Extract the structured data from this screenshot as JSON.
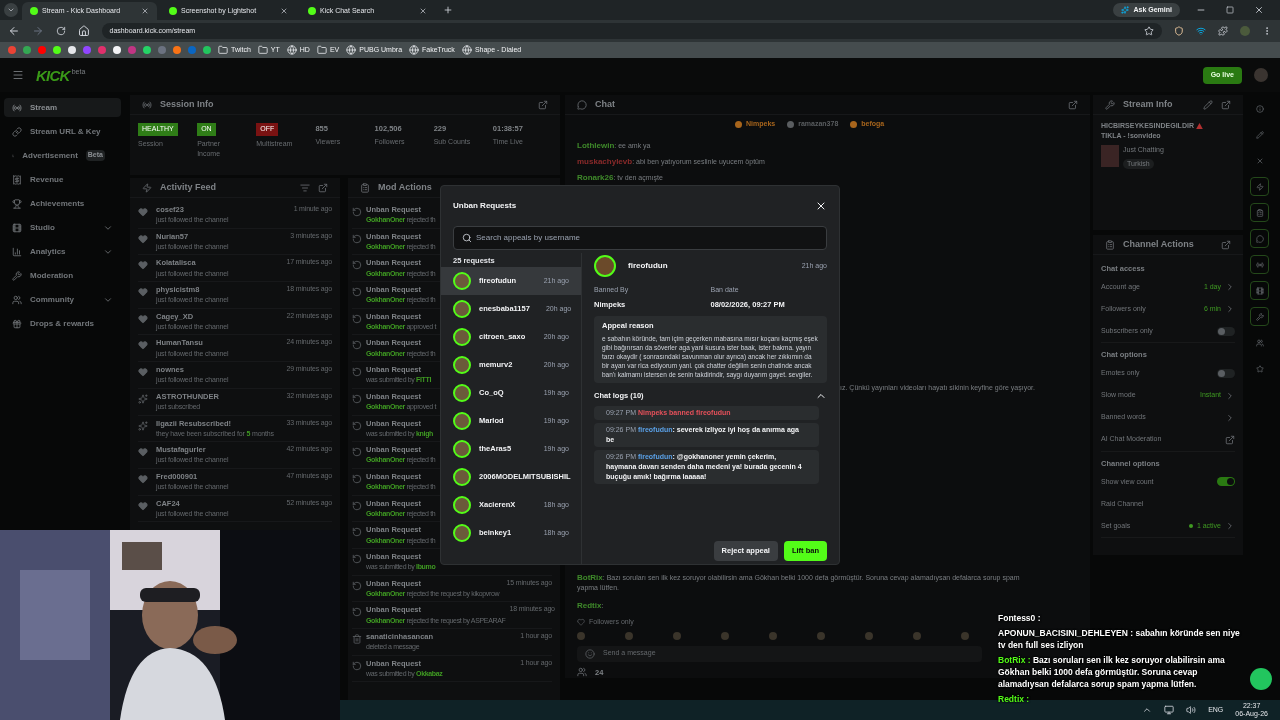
{
  "browser": {
    "tabs": [
      {
        "title": "Stream - Kick Dashboard",
        "selected": true
      },
      {
        "title": "Screenshot by Lightshot",
        "selected": false
      },
      {
        "title": "Kick Chat Search",
        "selected": false
      }
    ],
    "url": "dashboard.kick.com/stream",
    "assistant_button": "Ask Gemini",
    "bookmarks": [
      {
        "label": "Twitch",
        "kind": "folder"
      },
      {
        "label": "YT",
        "kind": "folder"
      },
      {
        "label": "HD",
        "kind": "site"
      },
      {
        "label": "EV",
        "kind": "folder"
      },
      {
        "label": "PUBG Umbra",
        "kind": "site"
      },
      {
        "label": "FakeTruck",
        "kind": "site"
      },
      {
        "label": "Shape - Dialed",
        "kind": "site"
      }
    ]
  },
  "header": {
    "logo": "KICK",
    "logo_tag": "beta",
    "go_live": "Go live"
  },
  "sidebar": {
    "items": [
      {
        "label": "Stream",
        "selected": true,
        "expandable": false
      },
      {
        "label": "Stream URL & Key",
        "selected": false,
        "expandable": false
      },
      {
        "label": "Advertisement",
        "badge": "Beta",
        "selected": false,
        "expandable": false
      },
      {
        "label": "Revenue",
        "selected": false,
        "expandable": false
      },
      {
        "label": "Achievements",
        "selected": false,
        "expandable": false
      },
      {
        "label": "Studio",
        "selected": false,
        "expandable": true
      },
      {
        "label": "Analytics",
        "selected": false,
        "expandable": true
      },
      {
        "label": "Moderation",
        "selected": false,
        "expandable": false
      },
      {
        "label": "Community",
        "selected": false,
        "expandable": true
      },
      {
        "label": "Drops & rewards",
        "selected": false,
        "expandable": false
      }
    ]
  },
  "session_info": {
    "title": "Session Info",
    "stats": [
      {
        "kind": "badge",
        "value": "HEALTHY",
        "label": "Session",
        "color": "#2f7d17"
      },
      {
        "kind": "badge",
        "value": "ON",
        "label": "Partner Income",
        "color": "#2f7d17"
      },
      {
        "kind": "badge",
        "value": "OFF",
        "label": "Multistream",
        "color": "#7a1212"
      },
      {
        "kind": "number",
        "value": "855",
        "label": "Viewers"
      },
      {
        "kind": "number",
        "value": "102,506",
        "label": "Followers"
      },
      {
        "kind": "number",
        "value": "229",
        "label": "Sub Counts"
      },
      {
        "kind": "number",
        "value": "01:38:57",
        "label": "Time Live"
      }
    ]
  },
  "activity_feed": {
    "title": "Activity Feed",
    "items": [
      {
        "kind": "follow",
        "name": "cosef23",
        "sub": "just followed the channel",
        "time": "1 minute ago"
      },
      {
        "kind": "follow",
        "name": "Nurian57",
        "sub": "just followed the channel",
        "time": "3 minutes ago"
      },
      {
        "kind": "follow",
        "name": "Kolatalisca",
        "sub": "just followed the channel",
        "time": "17 minutes ago"
      },
      {
        "kind": "follow",
        "name": "physicistm8",
        "sub": "just followed the channel",
        "time": "18 minutes ago"
      },
      {
        "kind": "follow",
        "name": "Cagey_XD",
        "sub": "just followed the channel",
        "time": "22 minutes ago"
      },
      {
        "kind": "follow",
        "name": "HumanTansu",
        "sub": "just followed the channel",
        "time": "24 minutes ago"
      },
      {
        "kind": "follow",
        "name": "nownes",
        "sub": "just followed the channel",
        "time": "29 minutes ago"
      },
      {
        "kind": "subscribe",
        "name": "ASTROTHUNDER",
        "sub": "just subscribed",
        "time": "32 minutes ago"
      },
      {
        "kind": "subscribe",
        "name": "Ilgazii Resubscribed!",
        "sub": "they have been subscribed for ",
        "highlight": "5",
        "sub_end": " months",
        "time": "33 minutes ago"
      },
      {
        "kind": "follow",
        "name": "Mustafagurler",
        "sub": "just followed the channel",
        "time": "42 minutes ago"
      },
      {
        "kind": "follow",
        "name": "Fred000901",
        "sub": "just followed the channel",
        "time": "47 minutes ago"
      },
      {
        "kind": "follow",
        "name": "CAF24",
        "sub": "just followed the channel",
        "time": "52 minutes ago"
      }
    ]
  },
  "mod_actions": {
    "title": "Mod Actions",
    "items": [
      {
        "kind": "unban",
        "title": "Unban Request",
        "name": "GokhanOner",
        "after": " rejected th"
      },
      {
        "kind": "unban",
        "title": "Unban Request",
        "name": "GokhanOner",
        "after": " rejected th"
      },
      {
        "kind": "unban",
        "title": "Unban Request",
        "name": "GokhanOner",
        "after": " rejected th"
      },
      {
        "kind": "unban",
        "title": "Unban Request",
        "name": "GokhanOner",
        "after": " rejected th"
      },
      {
        "kind": "unban",
        "title": "Unban Request",
        "name": "GokhanOner",
        "after": " approved t"
      },
      {
        "kind": "unban",
        "title": "Unban Request",
        "name": "GokhanOner",
        "after": " rejected th"
      },
      {
        "kind": "unban",
        "title": "Unban Request",
        "before": "was submitted by ",
        "name": "FITTI"
      },
      {
        "kind": "unban",
        "title": "Unban Request",
        "name": "GokhanOner",
        "after": " approved t"
      },
      {
        "kind": "unban",
        "title": "Unban Request",
        "before": "was submitted by ",
        "name": "knigh"
      },
      {
        "kind": "unban",
        "title": "Unban Request",
        "name": "GokhanOner",
        "after": " rejected th"
      },
      {
        "kind": "unban",
        "title": "Unban Request",
        "name": "GokhanOner",
        "after": " rejected th"
      },
      {
        "kind": "unban",
        "title": "Unban Request",
        "name": "GokhanOner",
        "after": " rejected th"
      },
      {
        "kind": "unban",
        "title": "Unban Request",
        "name": "GokhanOner",
        "after": " rejected th"
      },
      {
        "kind": "unban",
        "title": "Unban Request",
        "before": "was submitted by ",
        "name": "Ibumo"
      },
      {
        "kind": "unban",
        "title": "Unban Request",
        "name": "GokhanOner",
        "after": " rejected the request by kikopvrow",
        "time": "15 minutes ago"
      },
      {
        "kind": "unban",
        "title": "Unban Request",
        "name": "GokhanOner",
        "after": " rejected the request by ASPEARAF",
        "time": "18 minutes ago"
      },
      {
        "kind": "delete",
        "title": "sanaticinhasancan",
        "before": "deleted a message",
        "time": "1 hour ago"
      },
      {
        "kind": "unban",
        "title": "Unban Request",
        "before": "was submitted by ",
        "name": "Okkabaz",
        "time": "1 hour ago"
      }
    ]
  },
  "chat": {
    "title": "Chat",
    "top_chatters": [
      {
        "name": "Nimpeks",
        "color": "#a8651c"
      },
      {
        "name": "ramazan378",
        "color": "#5a5d60"
      },
      {
        "name": "befoga",
        "color": "#a8651c"
      }
    ],
    "messages": [
      {
        "user": "Lothlewin",
        "text": ": ee amk ya",
        "color": "#3f8a2a"
      },
      {
        "user": "muskachylevb",
        "text": ": abi ben yatıyorum seslinle uyucem öptüm",
        "color": "#8a2a2a"
      },
      {
        "user": "Ronark26",
        "text": ": tv den açmışte",
        "color": "#3f8a2a"
      }
    ],
    "cut_line": "ız. Çünkü yayınları videoları hayatı sikinin keyfine göre yaşıyor.",
    "bottom_messages": [
      {
        "user": "BotRix",
        "text": ": Bazı soruları sen ilk kez soruyor olabilirsin ama Gökhan belki 1000 defa görmüştür. Soruna cevap alamadıysan defalarca sorup spam yapma lütfen.",
        "color": "#3f8a2a"
      },
      {
        "user": "Redtix",
        "text": ":",
        "color": "#3f8a2a"
      }
    ],
    "mode": "Followers only",
    "input_placeholder": "Send a message",
    "viewer_count": "24"
  },
  "stream_info": {
    "title": "Stream Info",
    "stream_title": "HICBIRSEYKESINDEGILDIR",
    "stream_title_end": "TIKLA - !sonvideo",
    "category": "Just Chatting",
    "tag": "Turkish"
  },
  "channel_actions": {
    "title": "Channel Actions",
    "sections": [
      {
        "title": "Chat access",
        "rows": [
          {
            "kind": "value",
            "label": "Account age",
            "value": "1 day"
          },
          {
            "kind": "value",
            "label": "Followers only",
            "value": "6 min"
          },
          {
            "kind": "toggle",
            "label": "Subscribers only",
            "on": false
          }
        ]
      },
      {
        "title": "Chat options",
        "rows": [
          {
            "kind": "toggle",
            "label": "Emotes only",
            "on": false
          },
          {
            "kind": "value",
            "label": "Slow mode",
            "value": "Instant"
          },
          {
            "kind": "link",
            "label": "Banned words"
          },
          {
            "kind": "external",
            "label": "AI Chat Moderation"
          }
        ]
      },
      {
        "title": "Channel options",
        "rows": [
          {
            "kind": "toggle",
            "label": "Show view count",
            "on": true
          },
          {
            "kind": "plain",
            "label": "Raid Channel"
          },
          {
            "kind": "status",
            "label": "Set goals",
            "value": "1 active"
          }
        ]
      }
    ]
  },
  "unban_modal": {
    "title": "Unban Requests",
    "search_placeholder": "Search appeals by username",
    "count": "25 requests",
    "requests": [
      {
        "name": "fireofudun",
        "time": "21h ago",
        "selected": true
      },
      {
        "name": "enesbaba1157",
        "time": "20h ago",
        "selected": false
      },
      {
        "name": "citroen_saxo",
        "time": "20h ago",
        "selected": false
      },
      {
        "name": "memurv2",
        "time": "20h ago",
        "selected": false
      },
      {
        "name": "Co_oQ",
        "time": "19h ago",
        "selected": false
      },
      {
        "name": "Marlod",
        "time": "19h ago",
        "selected": false
      },
      {
        "name": "theAras5",
        "time": "19h ago",
        "selected": false
      },
      {
        "name": "2006MODELMITSUBISHIL",
        "selected": false
      },
      {
        "name": "XacierenX",
        "time": "18h ago",
        "selected": false
      },
      {
        "name": "beinkey1",
        "time": "18h ago",
        "selected": false
      }
    ],
    "detail": {
      "name": "fireofudun",
      "time": "21h ago",
      "banned_by_label": "Banned By",
      "banned_by": "Nimpeks",
      "ban_date_label": "Ban date",
      "ban_date": "08/02/2026, 09:27 PM",
      "appeal_title": "Appeal reason",
      "appeal_text": "e sabahın köründe, tam içim geçerken mabasına mısır koçanı kaçmış eşek gibi bağırırsan da söverler aga yani kusura ister baak, ister bakma. yayın tarzı okaydir ( sonrasındaki savunman olur ayrıca) ancak her zıkkımın da bir ayarı var rica ediyorum yani. çok chatter değilim senin chatinde ancak ban'ı kalmamı istersen de senin takdirindir, saygı duyarım gayet. sevgiler.",
      "logs_title": "Chat logs (10)",
      "logs_expanded": true,
      "logs": [
        {
          "kind": "ban",
          "time": "09:27 PM",
          "text": "Nimpeks banned fireofudun"
        },
        {
          "kind": "message",
          "time": "09:26 PM",
          "user": "fireofudun",
          "text": ": severek izliyoz iyi hoş da anırma aga be"
        },
        {
          "kind": "message",
          "time": "09:26 PM",
          "user": "fireofudun",
          "text": ": @gokhanoner yemin çekerim, haymana davarı senden daha medeni ya! burada gecenin 4 buçuğu amık! bağırma laaaaa!"
        }
      ]
    },
    "buttons": [
      {
        "label": "Reject appeal",
        "kind": "secondary"
      },
      {
        "label": "Lift ban",
        "kind": "primary"
      }
    ]
  },
  "overlay_chat": [
    {
      "user": "Fontess0 :",
      "color": "#ffffff"
    },
    {
      "user": "APONUN_BACISINI_DEHLEYEN :",
      "text": "sabahın köründe sen niye tv den full ses izliyon",
      "color": "#ffffff"
    },
    {
      "user": "BotRix :",
      "text": "Bazı soruları sen ilk kez soruyor olabilirsin ama Gökhan belki 1000 defa görmüştür. Soruna cevap alamadıysan defalarca sorup spam yapma lütfen.",
      "color": "#53fc18"
    },
    {
      "user": "Redtix :",
      "color": "#53fc18"
    }
  ],
  "taskbar": {
    "language": "ENG",
    "time": "22:37",
    "date": "06-Aug-26"
  }
}
